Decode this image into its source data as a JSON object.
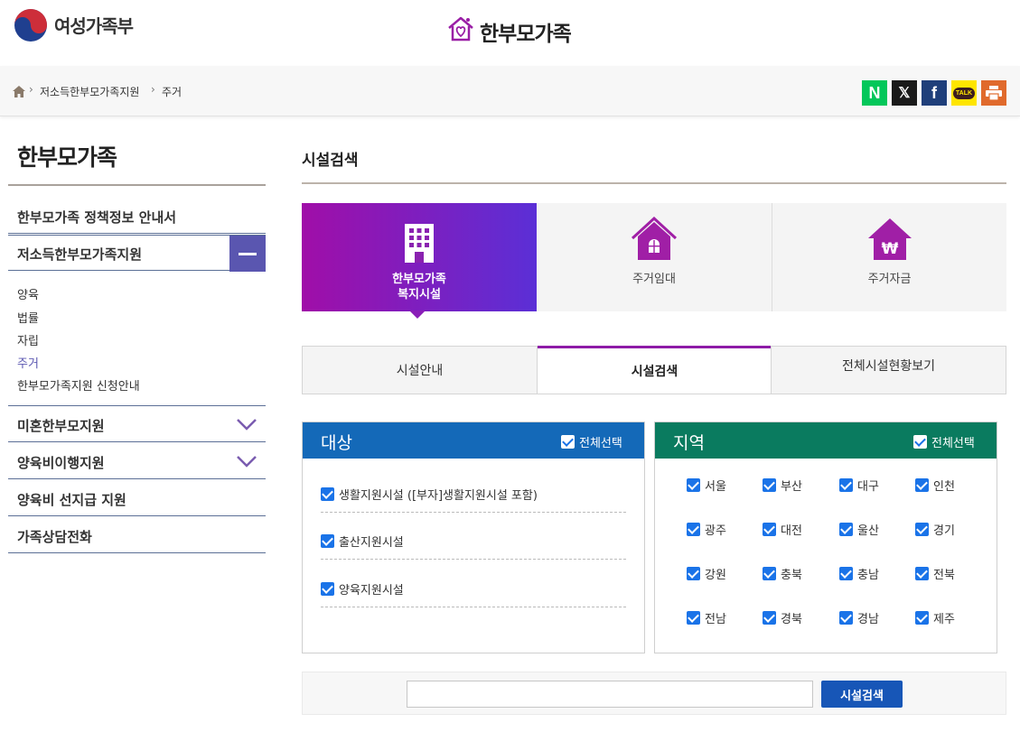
{
  "header": {
    "ministry_name": "여성가족부",
    "site_name": "한부모가족"
  },
  "breadcrumb": {
    "items": [
      "저소득한부모가족지원",
      "주거"
    ]
  },
  "share": {
    "naver": "N",
    "x": "𝕏",
    "facebook": "f",
    "kakao": "TALK"
  },
  "sidebar": {
    "title": "한부모가족",
    "items": [
      {
        "label": "한부모가족 정책정보 안내서"
      },
      {
        "label": "저소득한부모가족지원"
      },
      {
        "label": "미혼한부모지원"
      },
      {
        "label": "양육비이행지원"
      },
      {
        "label": "양육비 선지급 지원"
      },
      {
        "label": "가족상담전화"
      }
    ],
    "subitems": [
      "양육",
      "법률",
      "자립",
      "주거",
      "한부모가족지원 신청안내"
    ],
    "active_subitem": "주거"
  },
  "main": {
    "title": "시설검색",
    "categories": [
      {
        "label_line1": "한부모가족",
        "label_line2": "복지시설",
        "icon": "building-icon"
      },
      {
        "label_line1": "주거임대",
        "label_line2": "",
        "icon": "house-window-icon"
      },
      {
        "label_line1": "주거자금",
        "label_line2": "",
        "icon": "house-won-icon"
      }
    ],
    "tabs": [
      {
        "label": "시설안내"
      },
      {
        "label": "시설검색"
      },
      {
        "label": "전체시설현황보기"
      }
    ],
    "active_tab": "시설검색",
    "target_panel": {
      "title": "대상",
      "select_all": "전체선택",
      "color": "#1469b8",
      "options": [
        {
          "label": "생활지원시설 ([부자]생활지원시설 포함)",
          "checked": true
        },
        {
          "label": "출산지원시설",
          "checked": true
        },
        {
          "label": "양육지원시설",
          "checked": true
        }
      ]
    },
    "region_panel": {
      "title": "지역",
      "select_all": "전체선택",
      "color": "#0a7b5f",
      "regions": [
        "서울",
        "부산",
        "대구",
        "인천",
        "광주",
        "대전",
        "울산",
        "경기",
        "강원",
        "충북",
        "충남",
        "전북",
        "전남",
        "경북",
        "경남",
        "제주"
      ]
    },
    "search": {
      "input_value": "",
      "button_label": "시설검색"
    }
  },
  "colors": {
    "accent_purple": "#8e1ba7",
    "sidebar_toggle": "#5a56b0",
    "search_button": "#1756b7"
  }
}
